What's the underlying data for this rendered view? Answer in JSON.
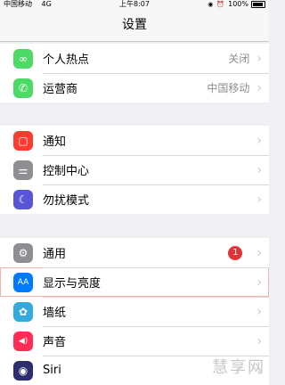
{
  "status": {
    "carrier": "中国移动",
    "network": "4G",
    "time": "上午8:07",
    "icons": [
      "rotation-lock-icon",
      "alarm-icon"
    ],
    "battery": "100%"
  },
  "nav": {
    "title": "设置"
  },
  "group1": [
    {
      "label": "个人热点",
      "detail": "关闭",
      "icon": "hotspot-icon",
      "color": "#4cd964",
      "glyph": "∞"
    },
    {
      "label": "运营商",
      "detail": "中国移动",
      "icon": "phone-icon",
      "color": "#4cd964",
      "glyph": "✆"
    }
  ],
  "group2": [
    {
      "label": "通知",
      "icon": "notification-icon",
      "color": "#ff3b30",
      "glyph": "▢"
    },
    {
      "label": "控制中心",
      "icon": "control-center-icon",
      "color": "#8e8e93",
      "glyph": "⚌"
    },
    {
      "label": "勿扰模式",
      "icon": "moon-icon",
      "color": "#5856d6",
      "glyph": "☾"
    }
  ],
  "group3": [
    {
      "label": "通用",
      "icon": "gear-icon",
      "color": "#8e8e93",
      "glyph": "⚙",
      "badge": "1"
    },
    {
      "label": "显示与亮度",
      "icon": "display-brightness-icon",
      "color": "#007aff",
      "glyph": "AA"
    },
    {
      "label": "墙纸",
      "icon": "wallpaper-icon",
      "color": "#34aadc",
      "glyph": "✿"
    },
    {
      "label": "声音",
      "icon": "speaker-icon",
      "color": "#ff2d55",
      "glyph": "◀)"
    },
    {
      "label": "Siri",
      "icon": "siri-icon",
      "color": "#2b2d6e",
      "glyph": "◉"
    }
  ],
  "chevron": "›",
  "watermark": "慧享网"
}
